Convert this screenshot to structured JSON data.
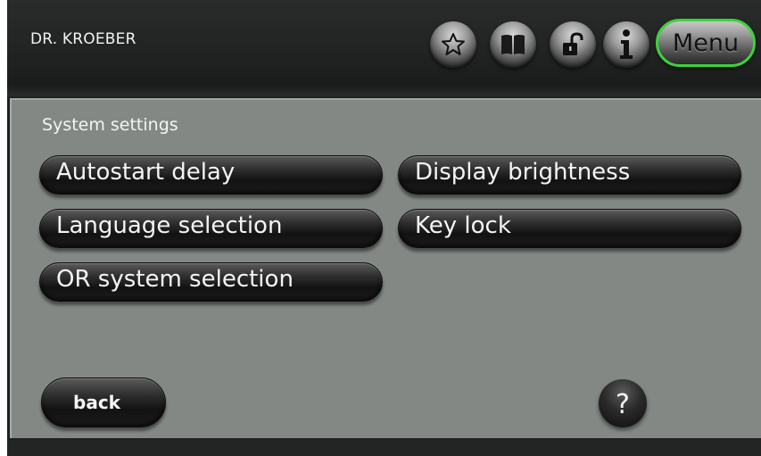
{
  "header": {
    "user_name": "DR. KROEBER",
    "icons": [
      "star-icon",
      "book-icon",
      "unlock-icon",
      "info-icon"
    ],
    "menu_label": "Menu",
    "menu_highlight_color": "#3cd33c"
  },
  "panel": {
    "title": "System settings",
    "buttons": [
      {
        "label": "Autostart delay"
      },
      {
        "label": "Display brightness"
      },
      {
        "label": "Language selection"
      },
      {
        "label": "Key lock"
      },
      {
        "label": "OR system selection"
      }
    ],
    "back_label": "back",
    "help_label": "?"
  },
  "colors": {
    "panel_background": "#838885",
    "header_background": "#1f2121"
  }
}
